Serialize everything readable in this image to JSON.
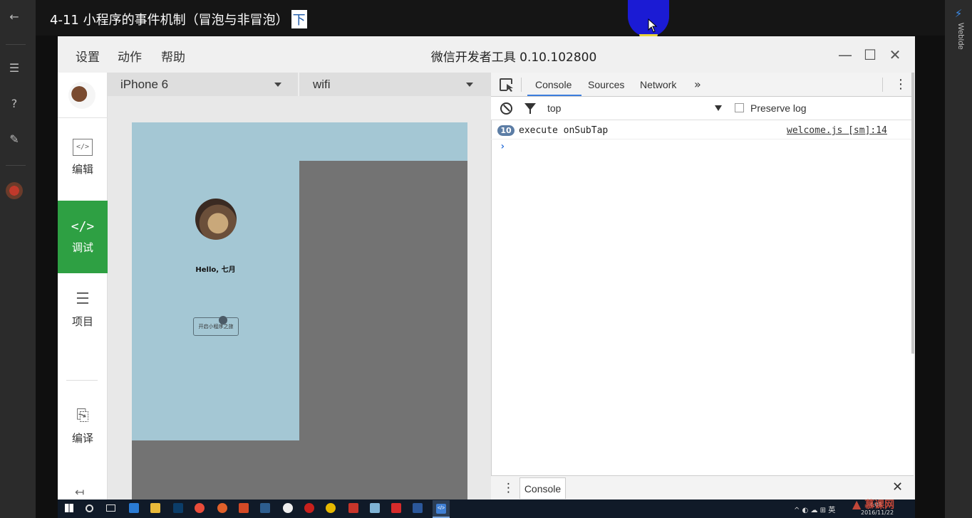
{
  "player": {
    "video_title": "4-11 小程序的事件机制（冒泡与非冒泡）",
    "title_highlight": "下",
    "right_panel_label": "WebIde",
    "left_icons": [
      "back-icon",
      "menu-icon",
      "help-icon",
      "edit-icon",
      "avatar-icon"
    ]
  },
  "app": {
    "menu": [
      "设置",
      "动作",
      "帮助"
    ],
    "title": "微信开发者工具 0.10.102800",
    "window_controls": [
      "minimize-icon",
      "maximize-icon",
      "close-icon"
    ]
  },
  "nav": {
    "items": [
      {
        "icon": "</>",
        "label": "编辑",
        "active": false
      },
      {
        "icon": "</>",
        "label": "调试",
        "active": true
      },
      {
        "icon": "☰",
        "label": "项目",
        "active": false
      },
      {
        "icon": "⎘",
        "label": "编译",
        "active": false
      }
    ],
    "active_color": "#2ea043"
  },
  "simulator": {
    "device": "iPhone 6",
    "network": "wifi",
    "greeting": "Hello, 七月",
    "button_label": "开启小程序之旅",
    "page_color": "#a4c7d4"
  },
  "devtools": {
    "tabs": [
      "Console",
      "Sources",
      "Network"
    ],
    "active_tab": "Console",
    "more_tabs": "»",
    "context": "top",
    "preserve_log_label": "Preserve log",
    "preserve_log_checked": false,
    "log": {
      "count": "10",
      "message": "execute onSubTap",
      "source": "welcome.js [sm]:14"
    },
    "prompt": "›",
    "drawer_tab": "Console"
  },
  "taskbar": {
    "tray": "^ ◐ ☁ ⊞ 英",
    "time": "4:08",
    "date": "2016/11/22",
    "accent": "#7aa6df"
  },
  "watermark": "慕课网"
}
